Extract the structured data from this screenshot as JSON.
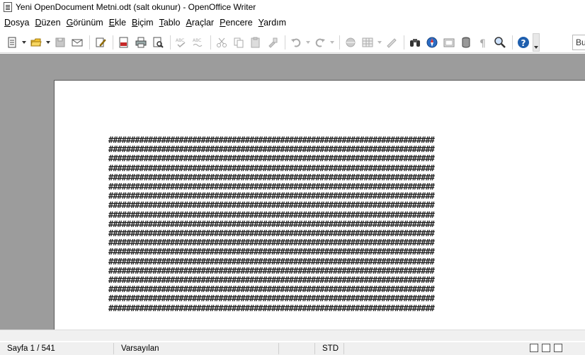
{
  "window": {
    "title": "Yeni OpenDocument Metni.odt (salt okunur) - OpenOffice Writer"
  },
  "menu": [
    {
      "label": "Dosya",
      "accel": "D",
      "rest": "osya"
    },
    {
      "label": "Düzen",
      "accel": "D",
      "rest": "üzen"
    },
    {
      "label": "Görünüm",
      "accel": "G",
      "rest": "örünüm"
    },
    {
      "label": "Ekle",
      "accel": "E",
      "rest": "kle"
    },
    {
      "label": "Biçim",
      "accel": "B",
      "rest": "içim"
    },
    {
      "label": "Tablo",
      "accel": "T",
      "rest": "ablo"
    },
    {
      "label": "Araçlar",
      "accel": "A",
      "rest": "raçlar"
    },
    {
      "label": "Pencere",
      "accel": "P",
      "rest": "encere"
    },
    {
      "label": "Yardım",
      "accel": "Y",
      "rest": "ardım"
    }
  ],
  "toolbar": {
    "style_value": "Bu"
  },
  "document": {
    "line_text": "##########################################################################",
    "line_count": 19
  },
  "status": {
    "page": "Sayfa 1 / 541",
    "style": "Varsayılan",
    "mode": "STD"
  },
  "colors": {
    "workspace": "#9c9c9c",
    "accent_help": "#1f5fae"
  }
}
